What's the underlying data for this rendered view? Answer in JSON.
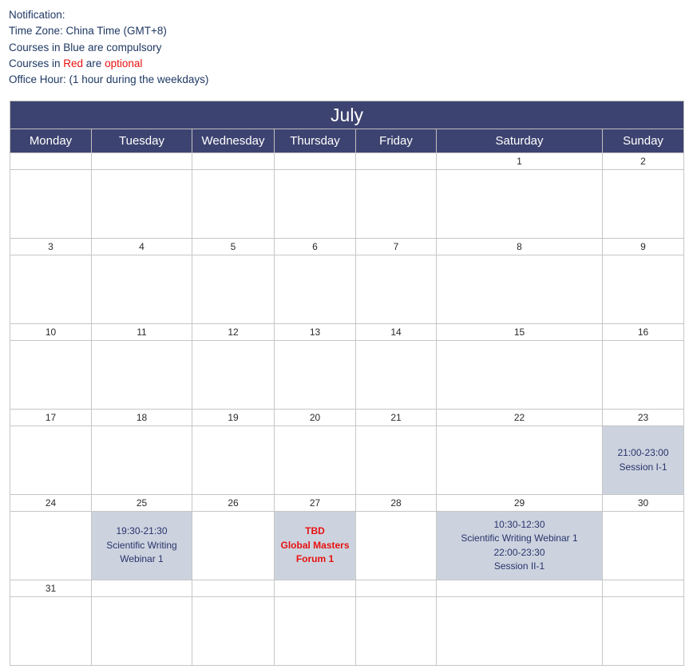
{
  "notification": {
    "lines": [
      {
        "segments": [
          {
            "text": "Notification:",
            "color": "navy"
          }
        ]
      },
      {
        "segments": [
          {
            "text": "Time Zone: China Time (GMT+8)",
            "color": "navy"
          }
        ]
      },
      {
        "segments": [
          {
            "text": "Courses in Blue are compulsory",
            "color": "navy"
          }
        ]
      },
      {
        "segments": [
          {
            "text": "Courses in ",
            "color": "navy"
          },
          {
            "text": "Red",
            "color": "red"
          },
          {
            "text": " are ",
            "color": "navy"
          },
          {
            "text": "optional",
            "color": "red"
          }
        ]
      },
      {
        "segments": [
          {
            "text": "Office Hour: (1 hour during the weekdays)",
            "color": "navy"
          }
        ]
      }
    ],
    "colors": {
      "navy": "#1f3864",
      "red": "#e8110f"
    }
  },
  "calendar": {
    "month_title": "July",
    "day_headers": [
      "Monday",
      "Tuesday",
      "Wednesday",
      "Thursday",
      "Friday",
      "Saturday",
      "Sunday"
    ],
    "colors": {
      "header_bg": "#3d4370",
      "header_text": "#ffffff",
      "event_bg": "#ccd3df",
      "event_text": "#29336b",
      "event_text_optional": "#e8110f",
      "grid_line": "#c6c6c6",
      "cell_bg": "#ffffff",
      "date_text": "#2a2a2a"
    },
    "weeks": [
      {
        "dates": [
          "",
          "",
          "",
          "",
          "",
          "1",
          "2"
        ],
        "events": [
          {
            "lines": []
          },
          {
            "lines": []
          },
          {
            "lines": []
          },
          {
            "lines": []
          },
          {
            "lines": []
          },
          {
            "lines": []
          },
          {
            "lines": []
          }
        ]
      },
      {
        "dates": [
          "3",
          "4",
          "5",
          "6",
          "7",
          "8",
          "9"
        ],
        "events": [
          {
            "lines": []
          },
          {
            "lines": []
          },
          {
            "lines": []
          },
          {
            "lines": []
          },
          {
            "lines": []
          },
          {
            "lines": []
          },
          {
            "lines": []
          }
        ]
      },
      {
        "dates": [
          "10",
          "11",
          "12",
          "13",
          "14",
          "15",
          "16"
        ],
        "events": [
          {
            "lines": []
          },
          {
            "lines": []
          },
          {
            "lines": []
          },
          {
            "lines": []
          },
          {
            "lines": []
          },
          {
            "lines": []
          },
          {
            "lines": []
          }
        ]
      },
      {
        "dates": [
          "17",
          "18",
          "19",
          "20",
          "21",
          "22",
          "23"
        ],
        "events": [
          {
            "lines": []
          },
          {
            "lines": []
          },
          {
            "lines": []
          },
          {
            "lines": []
          },
          {
            "lines": []
          },
          {
            "lines": []
          },
          {
            "style": "compulsory",
            "lines": [
              "21:00-23:00",
              "Session I-1"
            ]
          }
        ]
      },
      {
        "dates": [
          "24",
          "25",
          "26",
          "27",
          "28",
          "29",
          "30"
        ],
        "events": [
          {
            "lines": []
          },
          {
            "style": "compulsory",
            "lines": [
              "19:30-21:30",
              "Scientific Writing",
              "Webinar 1"
            ]
          },
          {
            "lines": []
          },
          {
            "style": "optional",
            "lines": [
              "TBD",
              "Global Masters",
              "Forum 1"
            ]
          },
          {
            "lines": []
          },
          {
            "style": "compulsory",
            "lines": [
              "10:30-12:30",
              "Scientific Writing Webinar 1",
              "22:00-23:30",
              "Session II-1"
            ]
          },
          {
            "lines": []
          }
        ]
      },
      {
        "dates": [
          "31",
          "",
          "",
          "",
          "",
          "",
          ""
        ],
        "events": [
          {
            "lines": []
          },
          {
            "lines": []
          },
          {
            "lines": []
          },
          {
            "lines": []
          },
          {
            "lines": []
          },
          {
            "lines": []
          },
          {
            "lines": []
          }
        ]
      }
    ]
  }
}
